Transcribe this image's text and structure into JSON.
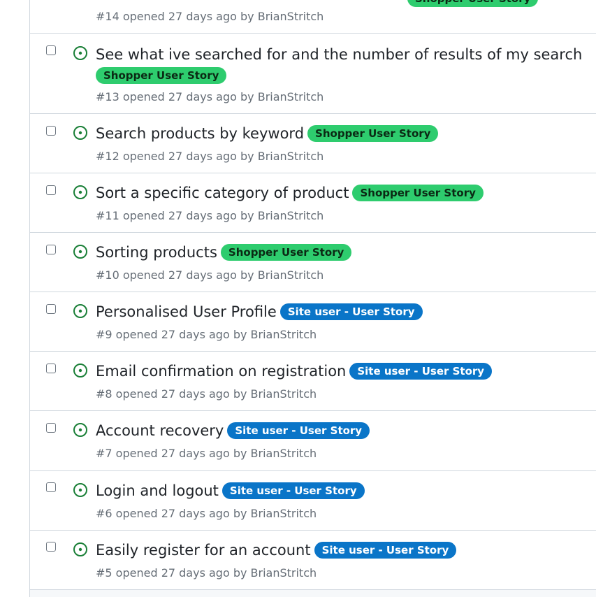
{
  "labels": {
    "shopper": "Shopper User Story",
    "siteuser": "Site user - User Story"
  },
  "colors": {
    "open_icon": "#1a7f37",
    "shopper_label_bg": "#2ecc6e",
    "siteuser_label_bg": "#0a75c8",
    "meta_text": "#656d76",
    "title_text": "#1f2328"
  },
  "issues": [
    {
      "title": "",
      "label": "Shopper User Story",
      "meta": "#14 opened 27 days ago by BrianStritch"
    },
    {
      "title": "See what ive searched for and the number of results of my search",
      "label": "Shopper User Story",
      "meta": "#13 opened 27 days ago by BrianStritch"
    },
    {
      "title": "Search products by keyword",
      "label": "Shopper User Story",
      "meta": "#12 opened 27 days ago by BrianStritch"
    },
    {
      "title": "Sort a specific category of product",
      "label": "Shopper User Story",
      "meta": "#11 opened 27 days ago by BrianStritch"
    },
    {
      "title": "Sorting products",
      "label": "Shopper User Story",
      "meta": "#10 opened 27 days ago by BrianStritch"
    },
    {
      "title": "Personalised User Profile",
      "label": "Site user - User Story",
      "meta": "#9 opened 27 days ago by BrianStritch"
    },
    {
      "title": "Email confirmation on registration",
      "label": "Site user - User Story",
      "meta": "#8 opened 27 days ago by BrianStritch"
    },
    {
      "title": "Account recovery",
      "label": "Site user - User Story",
      "meta": "#7 opened 27 days ago by BrianStritch"
    },
    {
      "title": "Login and logout",
      "label": "Site user - User Story",
      "meta": "#6 opened 27 days ago by BrianStritch"
    },
    {
      "title": "Easily register for an account",
      "label": "Site user - User Story",
      "meta": "#5 opened 27 days ago by BrianStritch"
    }
  ]
}
